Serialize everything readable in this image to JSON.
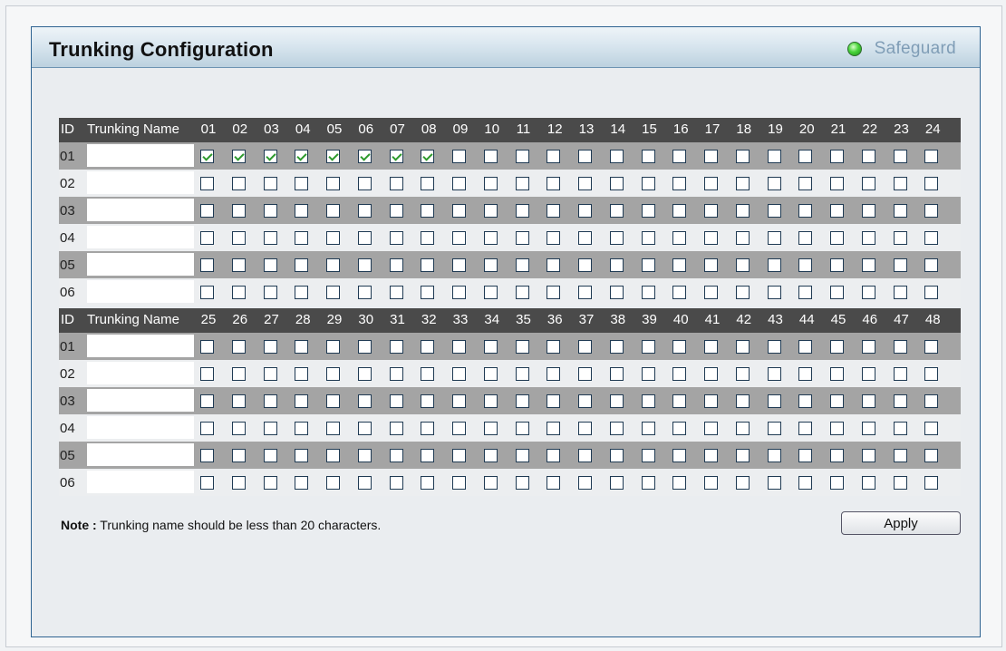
{
  "header": {
    "title": "Trunking Configuration",
    "status_label": "Safeguard",
    "status_color": "#3cc83a"
  },
  "table": {
    "id_header": "ID",
    "name_header": "Trunking Name",
    "groups": [
      {
        "ports": [
          "01",
          "02",
          "03",
          "04",
          "05",
          "06",
          "07",
          "08",
          "09",
          "10",
          "11",
          "12",
          "13",
          "14",
          "15",
          "16",
          "17",
          "18",
          "19",
          "20",
          "21",
          "22",
          "23",
          "24"
        ],
        "rows": [
          {
            "id": "01",
            "name": "",
            "checked": [
              true,
              true,
              true,
              true,
              true,
              true,
              true,
              true,
              false,
              false,
              false,
              false,
              false,
              false,
              false,
              false,
              false,
              false,
              false,
              false,
              false,
              false,
              false,
              false
            ]
          },
          {
            "id": "02",
            "name": "",
            "checked": [
              false,
              false,
              false,
              false,
              false,
              false,
              false,
              false,
              false,
              false,
              false,
              false,
              false,
              false,
              false,
              false,
              false,
              false,
              false,
              false,
              false,
              false,
              false,
              false
            ]
          },
          {
            "id": "03",
            "name": "",
            "checked": [
              false,
              false,
              false,
              false,
              false,
              false,
              false,
              false,
              false,
              false,
              false,
              false,
              false,
              false,
              false,
              false,
              false,
              false,
              false,
              false,
              false,
              false,
              false,
              false
            ]
          },
          {
            "id": "04",
            "name": "",
            "checked": [
              false,
              false,
              false,
              false,
              false,
              false,
              false,
              false,
              false,
              false,
              false,
              false,
              false,
              false,
              false,
              false,
              false,
              false,
              false,
              false,
              false,
              false,
              false,
              false
            ]
          },
          {
            "id": "05",
            "name": "",
            "checked": [
              false,
              false,
              false,
              false,
              false,
              false,
              false,
              false,
              false,
              false,
              false,
              false,
              false,
              false,
              false,
              false,
              false,
              false,
              false,
              false,
              false,
              false,
              false,
              false
            ]
          },
          {
            "id": "06",
            "name": "",
            "checked": [
              false,
              false,
              false,
              false,
              false,
              false,
              false,
              false,
              false,
              false,
              false,
              false,
              false,
              false,
              false,
              false,
              false,
              false,
              false,
              false,
              false,
              false,
              false,
              false
            ]
          }
        ]
      },
      {
        "ports": [
          "25",
          "26",
          "27",
          "28",
          "29",
          "30",
          "31",
          "32",
          "33",
          "34",
          "35",
          "36",
          "37",
          "38",
          "39",
          "40",
          "41",
          "42",
          "43",
          "44",
          "45",
          "46",
          "47",
          "48"
        ],
        "rows": [
          {
            "id": "01",
            "name": "",
            "checked": [
              false,
              false,
              false,
              false,
              false,
              false,
              false,
              false,
              false,
              false,
              false,
              false,
              false,
              false,
              false,
              false,
              false,
              false,
              false,
              false,
              false,
              false,
              false,
              false
            ]
          },
          {
            "id": "02",
            "name": "",
            "checked": [
              false,
              false,
              false,
              false,
              false,
              false,
              false,
              false,
              false,
              false,
              false,
              false,
              false,
              false,
              false,
              false,
              false,
              false,
              false,
              false,
              false,
              false,
              false,
              false
            ]
          },
          {
            "id": "03",
            "name": "",
            "checked": [
              false,
              false,
              false,
              false,
              false,
              false,
              false,
              false,
              false,
              false,
              false,
              false,
              false,
              false,
              false,
              false,
              false,
              false,
              false,
              false,
              false,
              false,
              false,
              false
            ]
          },
          {
            "id": "04",
            "name": "",
            "checked": [
              false,
              false,
              false,
              false,
              false,
              false,
              false,
              false,
              false,
              false,
              false,
              false,
              false,
              false,
              false,
              false,
              false,
              false,
              false,
              false,
              false,
              false,
              false,
              false
            ]
          },
          {
            "id": "05",
            "name": "",
            "checked": [
              false,
              false,
              false,
              false,
              false,
              false,
              false,
              false,
              false,
              false,
              false,
              false,
              false,
              false,
              false,
              false,
              false,
              false,
              false,
              false,
              false,
              false,
              false,
              false
            ]
          },
          {
            "id": "06",
            "name": "",
            "checked": [
              false,
              false,
              false,
              false,
              false,
              false,
              false,
              false,
              false,
              false,
              false,
              false,
              false,
              false,
              false,
              false,
              false,
              false,
              false,
              false,
              false,
              false,
              false,
              false
            ]
          }
        ]
      }
    ]
  },
  "footer": {
    "note_label": "Note :",
    "note_text": " Trunking name should be less than 20 characters.",
    "apply_label": "Apply"
  }
}
